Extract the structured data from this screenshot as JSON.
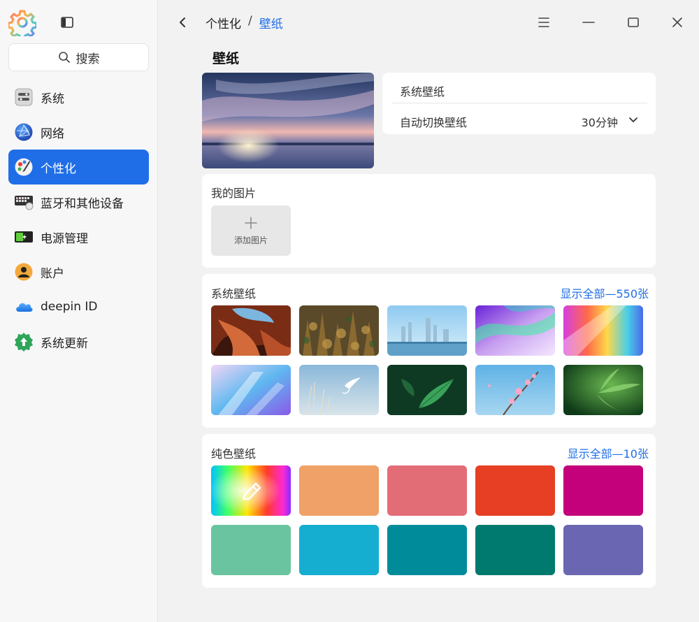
{
  "sidebar": {
    "search_label": "搜索",
    "items": [
      {
        "label": "系统",
        "icon": "system-icon"
      },
      {
        "label": "网络",
        "icon": "network-icon"
      },
      {
        "label": "个性化",
        "icon": "personalization-icon"
      },
      {
        "label": "蓝牙和其他设备",
        "icon": "bluetooth-devices-icon"
      },
      {
        "label": "电源管理",
        "icon": "power-icon"
      },
      {
        "label": "账户",
        "icon": "account-icon"
      },
      {
        "label": "deepin ID",
        "icon": "cloud-icon"
      },
      {
        "label": "系统更新",
        "icon": "update-icon"
      }
    ]
  },
  "breadcrumb": {
    "parent": "个性化",
    "separator": "/",
    "current": "壁纸"
  },
  "page_title": "壁纸",
  "wallpaper_info": {
    "source": "系统壁纸",
    "auto_switch_label": "自动切换壁纸",
    "auto_switch_value": "30分钟"
  },
  "my_pictures": {
    "title": "我的图片",
    "add_label": "添加图片"
  },
  "system_wallpapers": {
    "title": "系统壁纸",
    "show_all": "显示全部—550张",
    "tiles": [
      "red-rock-canyon",
      "autumn-forest",
      "city-skyline",
      "aurora-purple",
      "rainbow-light",
      "blue-glass",
      "white-crane-reeds",
      "green-leaf",
      "peach-blossom",
      "bamboo-leaves"
    ]
  },
  "solid_wallpapers": {
    "title": "纯色壁纸",
    "show_all": "显示全部—10张",
    "colors": [
      "#f0a167",
      "#e36d77",
      "#e73f23",
      "#c4007a",
      "#6ac4a0",
      "#15aed0",
      "#008b9b",
      "#007a6e",
      "#6b66b1"
    ]
  },
  "accent_color": "#1f6ee8"
}
